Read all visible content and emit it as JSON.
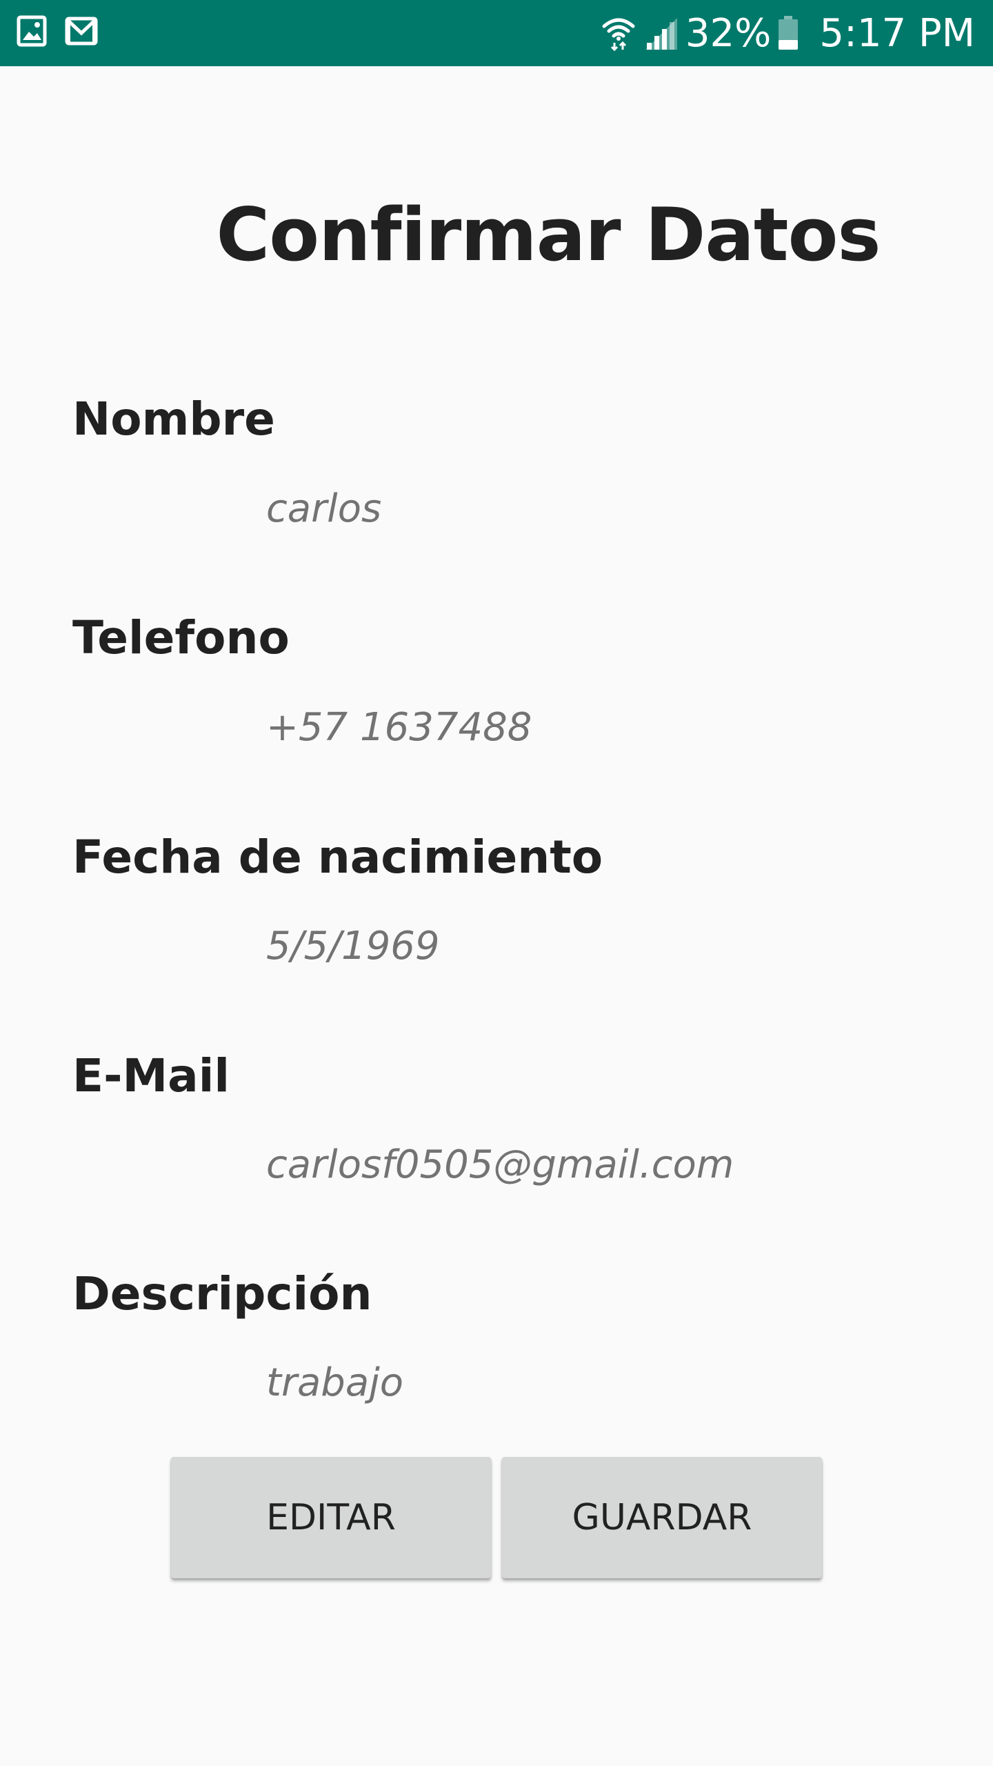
{
  "status_bar": {
    "icons_left": [
      "gallery-icon",
      "gmail-icon"
    ],
    "icons_right": [
      "wifi-icon",
      "signal-icon",
      "battery-icon"
    ],
    "battery": "32%",
    "time": "5:17 PM",
    "color": "#00796b"
  },
  "page": {
    "title": "Confirmar Datos"
  },
  "fields": [
    {
      "label": "Nombre",
      "value": "carlos"
    },
    {
      "label": "Telefono",
      "value": "+57 1637488"
    },
    {
      "label": "Fecha de nacimiento",
      "value": "5/5/1969"
    },
    {
      "label": "E-Mail",
      "value": "carlosf0505@gmail.com"
    },
    {
      "label": "Descripción",
      "value": "trabajo"
    }
  ],
  "actions": {
    "edit_label": "EDITAR",
    "save_label": "GUARDAR"
  }
}
